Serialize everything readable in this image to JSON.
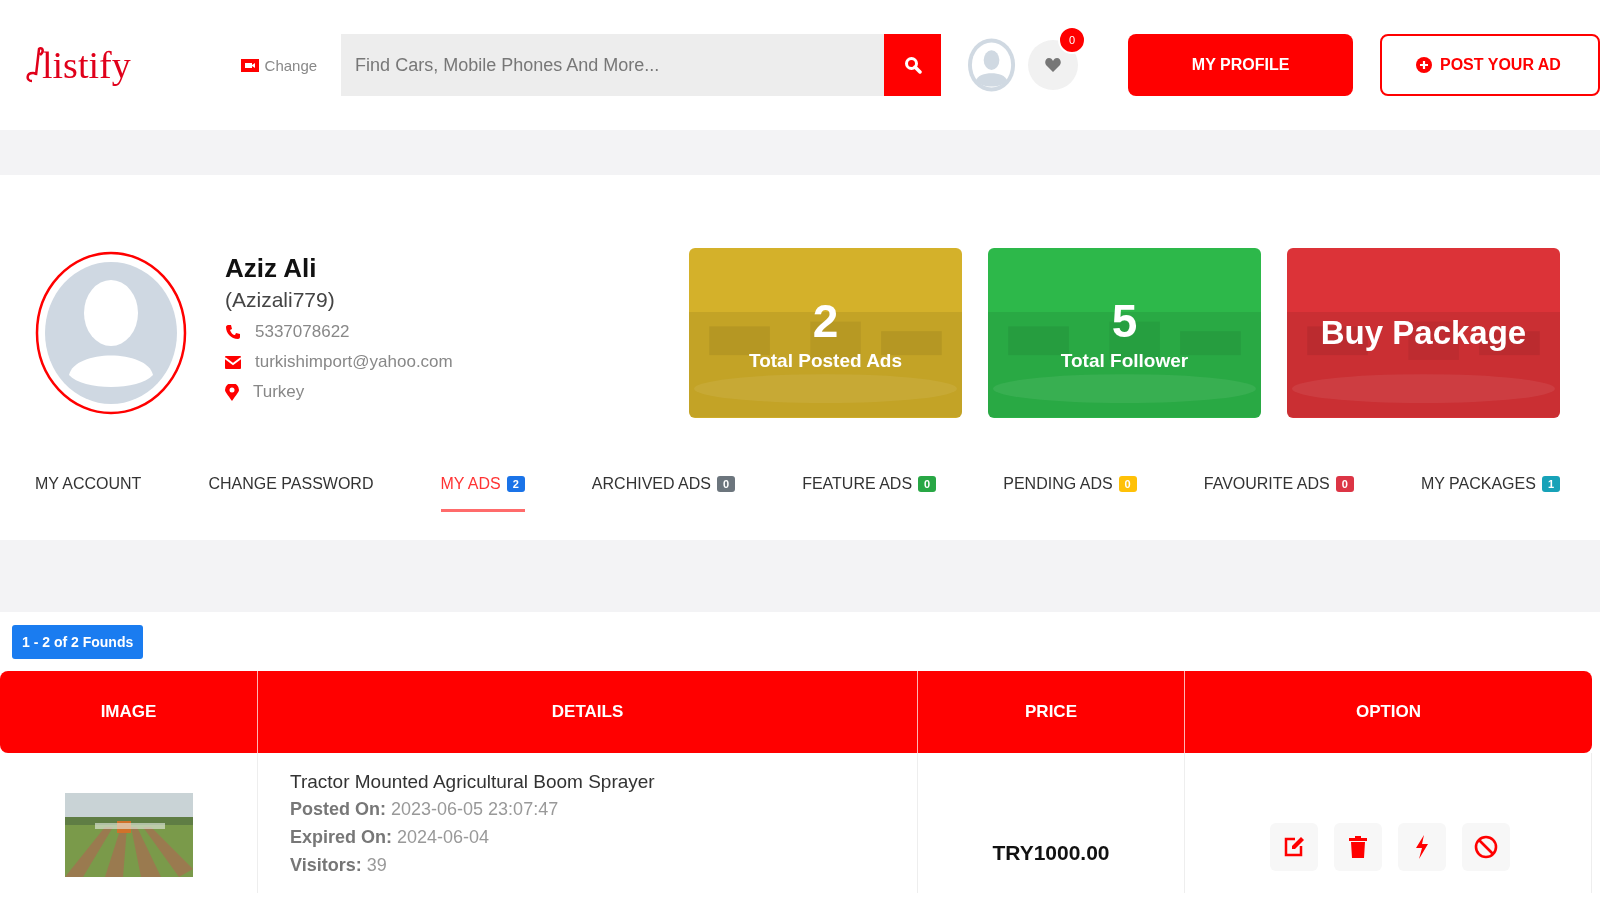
{
  "header": {
    "logo": "listify",
    "change_label": "Change",
    "search": {
      "placeholder": "Find Cars, Mobile Phones And More..."
    },
    "favourites_count": "0",
    "buttons": [
      {
        "label": "MY PROFILE",
        "kind": "filled"
      },
      {
        "label": "POST YOUR AD",
        "kind": "outline"
      }
    ]
  },
  "profile": {
    "name": "Aziz Ali",
    "username": "(Azizali779)",
    "phone": "5337078622",
    "email": "turkishimport@yahoo.com",
    "location": "Turkey"
  },
  "stats": [
    {
      "value": "2",
      "label": "Total Posted Ads",
      "color": "#d4b12a"
    },
    {
      "value": "5",
      "label": "Total Follower",
      "color": "#2db84a"
    },
    {
      "label": "Buy Package",
      "color": "#dc3338"
    }
  ],
  "tabs": [
    {
      "label": "MY ACCOUNT",
      "selected": false
    },
    {
      "label": "CHANGE PASSWORD",
      "selected": false
    },
    {
      "label": "MY ADS",
      "count": "2",
      "color": "#1a73e8",
      "selected": true
    },
    {
      "label": "ARCHIVED ADS",
      "count": "0",
      "color": "#6c757d",
      "selected": false
    },
    {
      "label": "FEATURE ADS",
      "count": "0",
      "color": "#28a745",
      "selected": false
    },
    {
      "label": "PENDING ADS",
      "count": "0",
      "color": "#ffc107",
      "selected": false
    },
    {
      "label": "FAVOURITE ADS",
      "count": "0",
      "color": "#dc3545",
      "selected": false
    },
    {
      "label": "MY PACKAGES",
      "count": "1",
      "color": "#17a2b8",
      "selected": false
    }
  ],
  "results_badge": "1 - 2 of 2 Founds",
  "table": {
    "columns": [
      "IMAGE",
      "DETAILS",
      "PRICE",
      "OPTION"
    ],
    "rows": [
      {
        "image": {
          "kind": "picture"
        },
        "title": "Tractor Mounted Agricultural Boom Sprayer",
        "details": [
          "**Posted On:** 2023-06-05 23:07:47",
          "**Expired On:** 2024-06-04",
          "**Visitors:** 39"
        ],
        "price": "TRY1000.00"
      }
    ]
  }
}
